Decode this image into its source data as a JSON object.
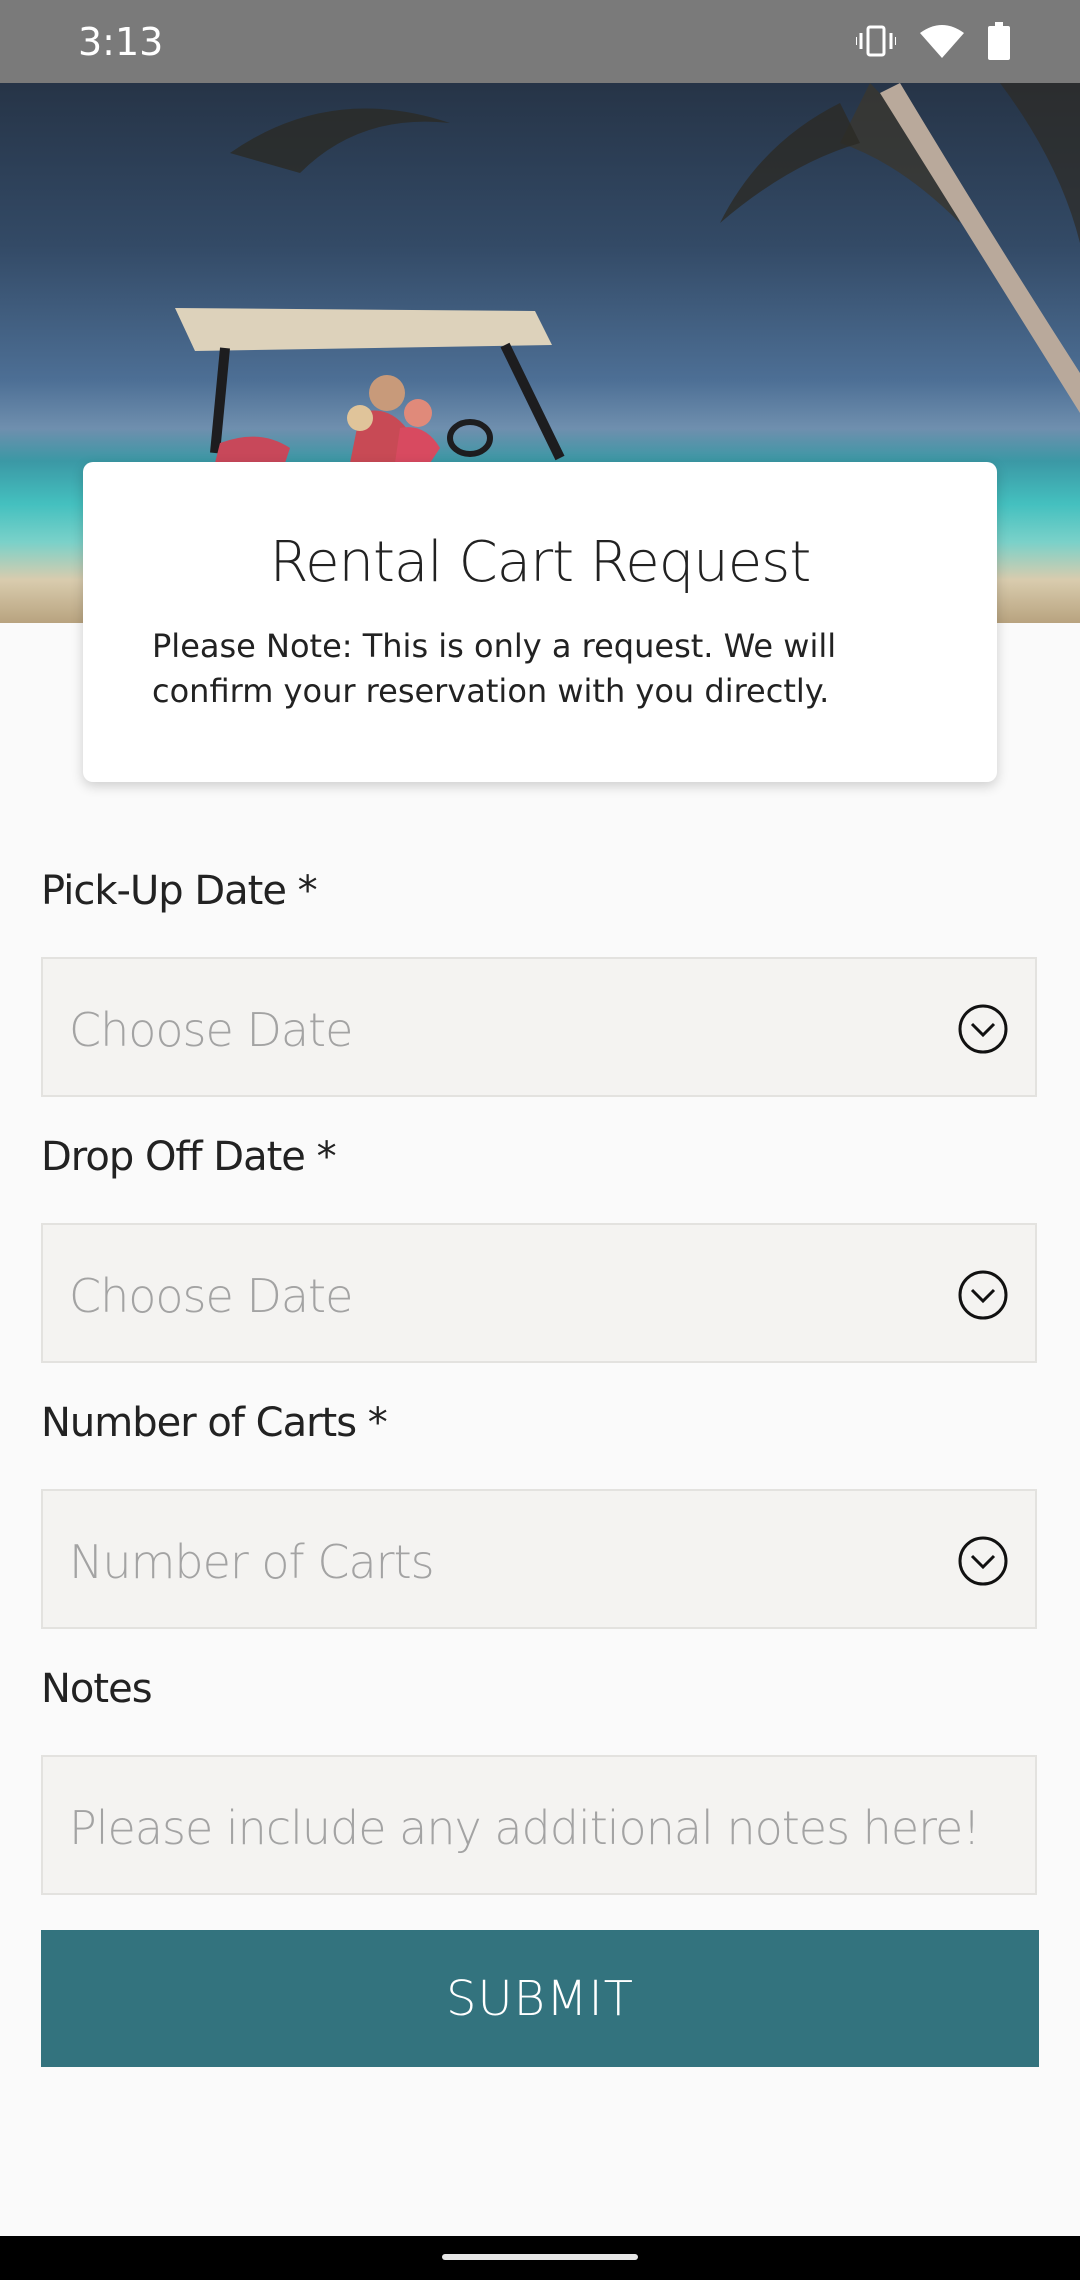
{
  "status_bar": {
    "time": "3:13",
    "icons": [
      "vibrate-icon",
      "wifi-icon",
      "battery-icon"
    ]
  },
  "hero": {
    "image": "beach golf cart photo"
  },
  "card": {
    "title": "Rental Cart Request",
    "note": "Please Note: This is only a request. We will confirm your reservation with you directly."
  },
  "form": {
    "pickup": {
      "label": "Pick-Up Date *",
      "placeholder": "Choose Date"
    },
    "dropoff": {
      "label": "Drop Off Date *",
      "placeholder": "Choose Date"
    },
    "carts": {
      "label": "Number of Carts *",
      "placeholder": "Number of Carts"
    },
    "notes": {
      "label": "Notes",
      "placeholder": "Please include any additional notes here!"
    }
  },
  "submit": {
    "label": "SUBMIT"
  },
  "colors": {
    "accent": "#33737e",
    "field_bg": "#f4f3f1",
    "status_bar": "#7a7a7a"
  }
}
